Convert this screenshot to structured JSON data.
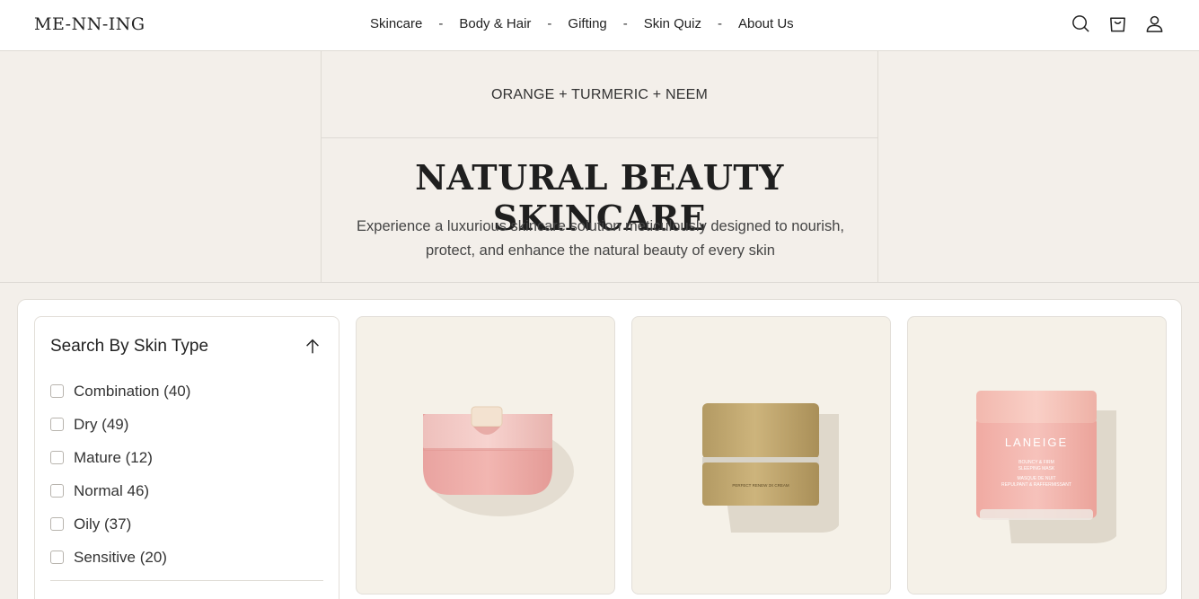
{
  "header": {
    "logo": "ME-NN-ING",
    "nav": [
      {
        "label": "Skincare"
      },
      {
        "label": "Body & Hair"
      },
      {
        "label": "Gifting"
      },
      {
        "label": "Skin Quiz"
      },
      {
        "label": "About Us"
      }
    ],
    "nav_separator": "-",
    "icons": [
      "search-icon",
      "cart-icon",
      "account-icon"
    ]
  },
  "hero": {
    "eyebrow": "ORANGE + TURMERIC + NEEM",
    "title": "NATURAL BEAUTY SKINCARE",
    "description": "Experience a luxurious skincare solution meticulously designed to nourish, protect, and enhance the natural beauty of every skin"
  },
  "filter": {
    "title": "Search By Skin Type",
    "toggle_icon": "arrow-up-icon",
    "options": [
      {
        "label": "Combination (40)",
        "checked": false
      },
      {
        "label": "Dry (49)",
        "checked": false
      },
      {
        "label": "Mature (12)",
        "checked": false
      },
      {
        "label": "Normal  46)",
        "checked": false
      },
      {
        "label": "Oily (37)",
        "checked": false
      },
      {
        "label": "Sensitive (20)",
        "checked": false
      }
    ]
  },
  "products": [
    {
      "image": "pink-cream-jar"
    },
    {
      "image": "gold-cream-jar",
      "jar_text": "PERFECT RENEW 3X CREAM"
    },
    {
      "image": "laneige-sleeping-mask-jar",
      "jar_brand": "LANEIGE",
      "jar_lines": [
        "BOUNCY & FIRM",
        "SLEEPING MASK",
        "MASQUE DE NUIT",
        "REPULPANT & RAFFERMISSANT"
      ]
    }
  ],
  "colors": {
    "page_bg": "#f3efea",
    "card_bg": "#f5f1e8",
    "border": "#dedad4",
    "text": "#222222"
  }
}
